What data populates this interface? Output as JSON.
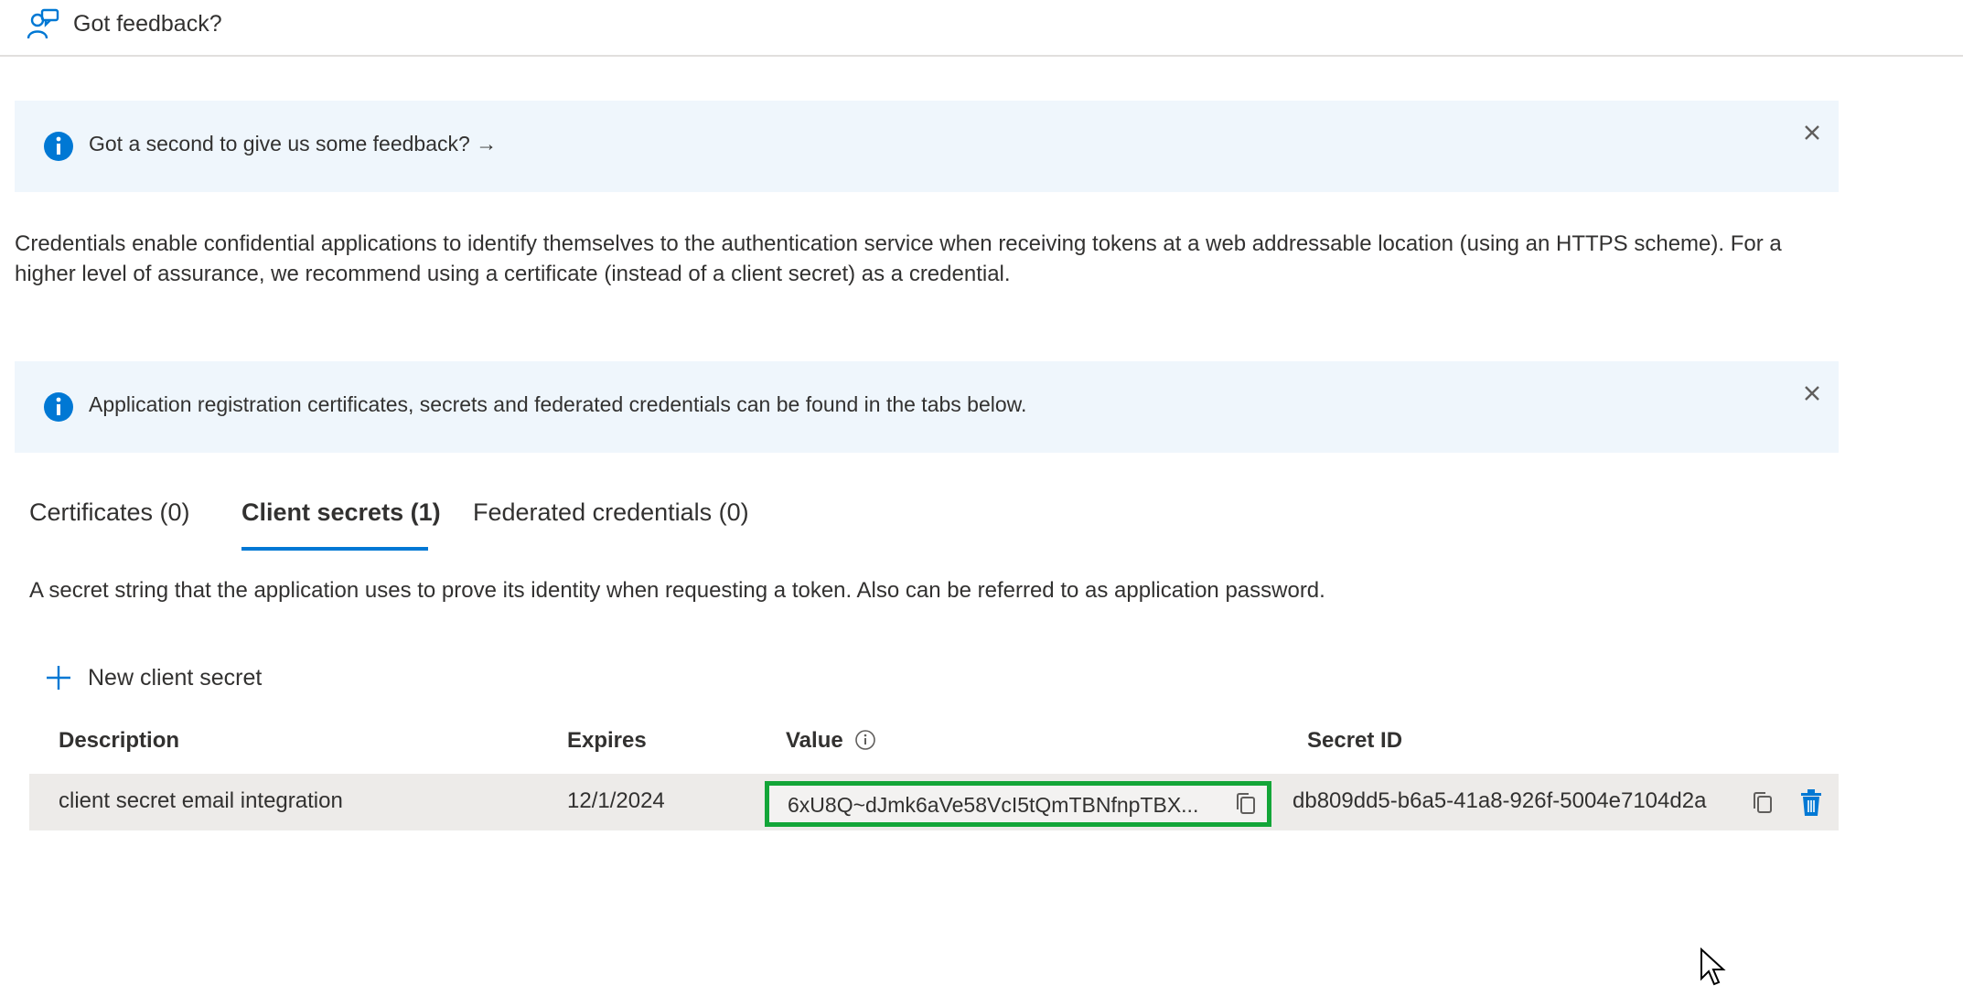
{
  "header": {
    "feedback_label": "Got feedback?",
    "feedback_icon": "feedback-person-icon"
  },
  "banners": [
    {
      "text": "Got a second to give us some feedback? →",
      "icon": "info-icon",
      "close_icon": "close-icon"
    },
    {
      "text": "Application registration certificates, secrets and federated credentials can be found in the tabs below.",
      "icon": "info-icon",
      "close_icon": "close-icon"
    }
  ],
  "description": "Credentials enable confidential applications to identify themselves to the authentication service when receiving tokens at a web addressable location (using an HTTPS scheme). For a higher level of assurance, we recommend using a certificate (instead of a client secret) as a credential.",
  "tabs": [
    {
      "label": "Certificates (0)",
      "active": false
    },
    {
      "label": "Client secrets (1)",
      "active": true
    },
    {
      "label": "Federated credentials (0)",
      "active": false
    }
  ],
  "tab_description": "A secret string that the application uses to prove its identity when requesting a token. Also can be referred to as application password.",
  "toolbar": {
    "new_secret_label": "New client secret",
    "new_secret_icon": "plus-icon"
  },
  "table": {
    "columns": [
      "Description",
      "Expires",
      "Value",
      "Secret ID"
    ],
    "value_info_icon": "info-circle-icon",
    "rows": [
      {
        "description": "client secret email integration",
        "expires": "12/1/2024",
        "value": "6xU8Q~dJmk6aVe58VcI5tQmTBNfnpTBX...",
        "secret_id": "db809dd5-b6a5-41a8-926f-5004e7104d2a"
      }
    ]
  },
  "colors": {
    "accent": "#0078d4",
    "highlight_border": "#13a538",
    "banner_bg": "#eff6fc",
    "row_bg": "#edebe9"
  }
}
